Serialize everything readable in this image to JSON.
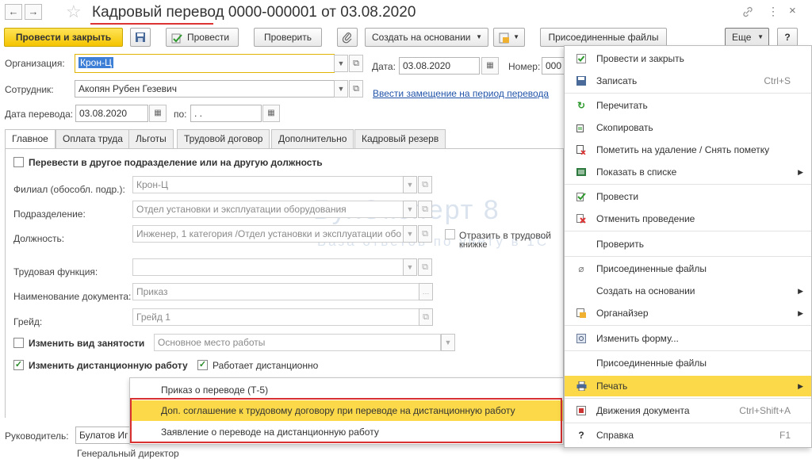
{
  "window": {
    "back": "←",
    "forward": "→",
    "star": "☆",
    "title": "Кадровый перевод 0000-000001 от 03.08.2020",
    "link_icon": "link-icon",
    "more": "⋮",
    "close": "×"
  },
  "toolbar": {
    "post_close": "Провести и закрыть",
    "post": "Провести",
    "check": "Проверить",
    "create_based": "Создать на основании",
    "attached": "Присоединенные файлы",
    "more": "Еще",
    "help": "?"
  },
  "form": {
    "org_label": "Организация:",
    "org_value": "Крон-Ц",
    "date_label": "Дата:",
    "date_value": "03.08.2020",
    "number_label": "Номер:",
    "number_value": "000",
    "employee_label": "Сотрудник:",
    "employee_value": "Акопян Рубен Гезевич",
    "replace_link": "Ввести замещение на период перевода",
    "transfer_date_label": "Дата перевода:",
    "transfer_date_value": "03.08.2020",
    "to_label": "по:",
    "to_value": " .  ."
  },
  "tabs": [
    "Главное",
    "Оплата труда",
    "Льготы",
    "Трудовой договор",
    "Дополнительно",
    "Кадровый резерв"
  ],
  "main": {
    "transfer_checkbox": "Перевести в другое подразделение или на другую должность",
    "branch_label": "Филиал (обособл. подр.):",
    "branch_value": "Крон-Ц",
    "dept_label": "Подразделение:",
    "dept_value": "Отдел установки и эксплуатации оборудования",
    "position_label": "Должность:",
    "position_value": "Инженер, 1 категория /Отдел установки и эксплуатации обо",
    "reflect_label_1": "Отразить в трудовой",
    "reflect_label_2": "книжке",
    "func_label": "Трудовая функция:",
    "func_value": "",
    "doc_name_label": "Наименование документа:",
    "doc_name_value": "Приказ",
    "grade_label": "Грейд:",
    "grade_value": "Грейд 1",
    "employment_checkbox": "Изменить вид занятости",
    "employment_value": "Основное место работы",
    "remote_checkbox": "Изменить дистанционную работу",
    "remote_works_checkbox": "Работает дистанционно",
    "manager_label": "Руководитель:",
    "manager_value": "Булатов Иг",
    "manager_position": "Генеральный директор"
  },
  "watermark": {
    "line1": "БухЭксперт 8",
    "line2": "База ответов по учету в 1С"
  },
  "menu": {
    "items": [
      {
        "label": "Провести и закрыть",
        "icon": "post-close-icon",
        "shortcut": ""
      },
      {
        "label": "Записать",
        "icon": "save-icon",
        "shortcut": "Ctrl+S"
      },
      {
        "label": "Перечитать",
        "icon": "refresh-icon",
        "shortcut": ""
      },
      {
        "label": "Скопировать",
        "icon": "copy-icon",
        "shortcut": ""
      },
      {
        "label": "Пометить на удаление / Снять пометку",
        "icon": "delete-mark-icon",
        "shortcut": ""
      },
      {
        "label": "Показать в списке",
        "icon": "list-icon",
        "shortcut": ""
      },
      {
        "label": "Провести",
        "icon": "post-icon",
        "shortcut": ""
      },
      {
        "label": "Отменить проведение",
        "icon": "unpost-icon",
        "shortcut": ""
      },
      {
        "label": "Проверить",
        "icon": "",
        "shortcut": ""
      },
      {
        "label": "Присоединенные файлы",
        "icon": "paperclip-icon",
        "shortcut": ""
      },
      {
        "label": "Создать на основании",
        "icon": "",
        "shortcut": ""
      },
      {
        "label": "Органайзер",
        "icon": "organizer-icon",
        "shortcut": ""
      },
      {
        "label": "Изменить форму...",
        "icon": "form-settings-icon",
        "shortcut": ""
      },
      {
        "label": "Присоединенные файлы",
        "icon": "",
        "shortcut": ""
      },
      {
        "label": "Печать",
        "icon": "printer-icon",
        "shortcut": ""
      },
      {
        "label": "Движения документа",
        "icon": "movements-icon",
        "shortcut": "Ctrl+Shift+A"
      },
      {
        "label": "Справка",
        "icon": "help-icon",
        "shortcut": "F1"
      }
    ]
  },
  "print_submenu": {
    "items": [
      "Приказ о переводе (Т-5)",
      "Доп. соглашение к трудовому договору при переводе на дистанционную работу",
      "Заявление о переводе на дистанционную работу"
    ]
  },
  "colors": {
    "accent_yellow": "#f5c400",
    "highlight": "#fbd948",
    "red_outline": "#d93030",
    "link": "#2255aa"
  }
}
